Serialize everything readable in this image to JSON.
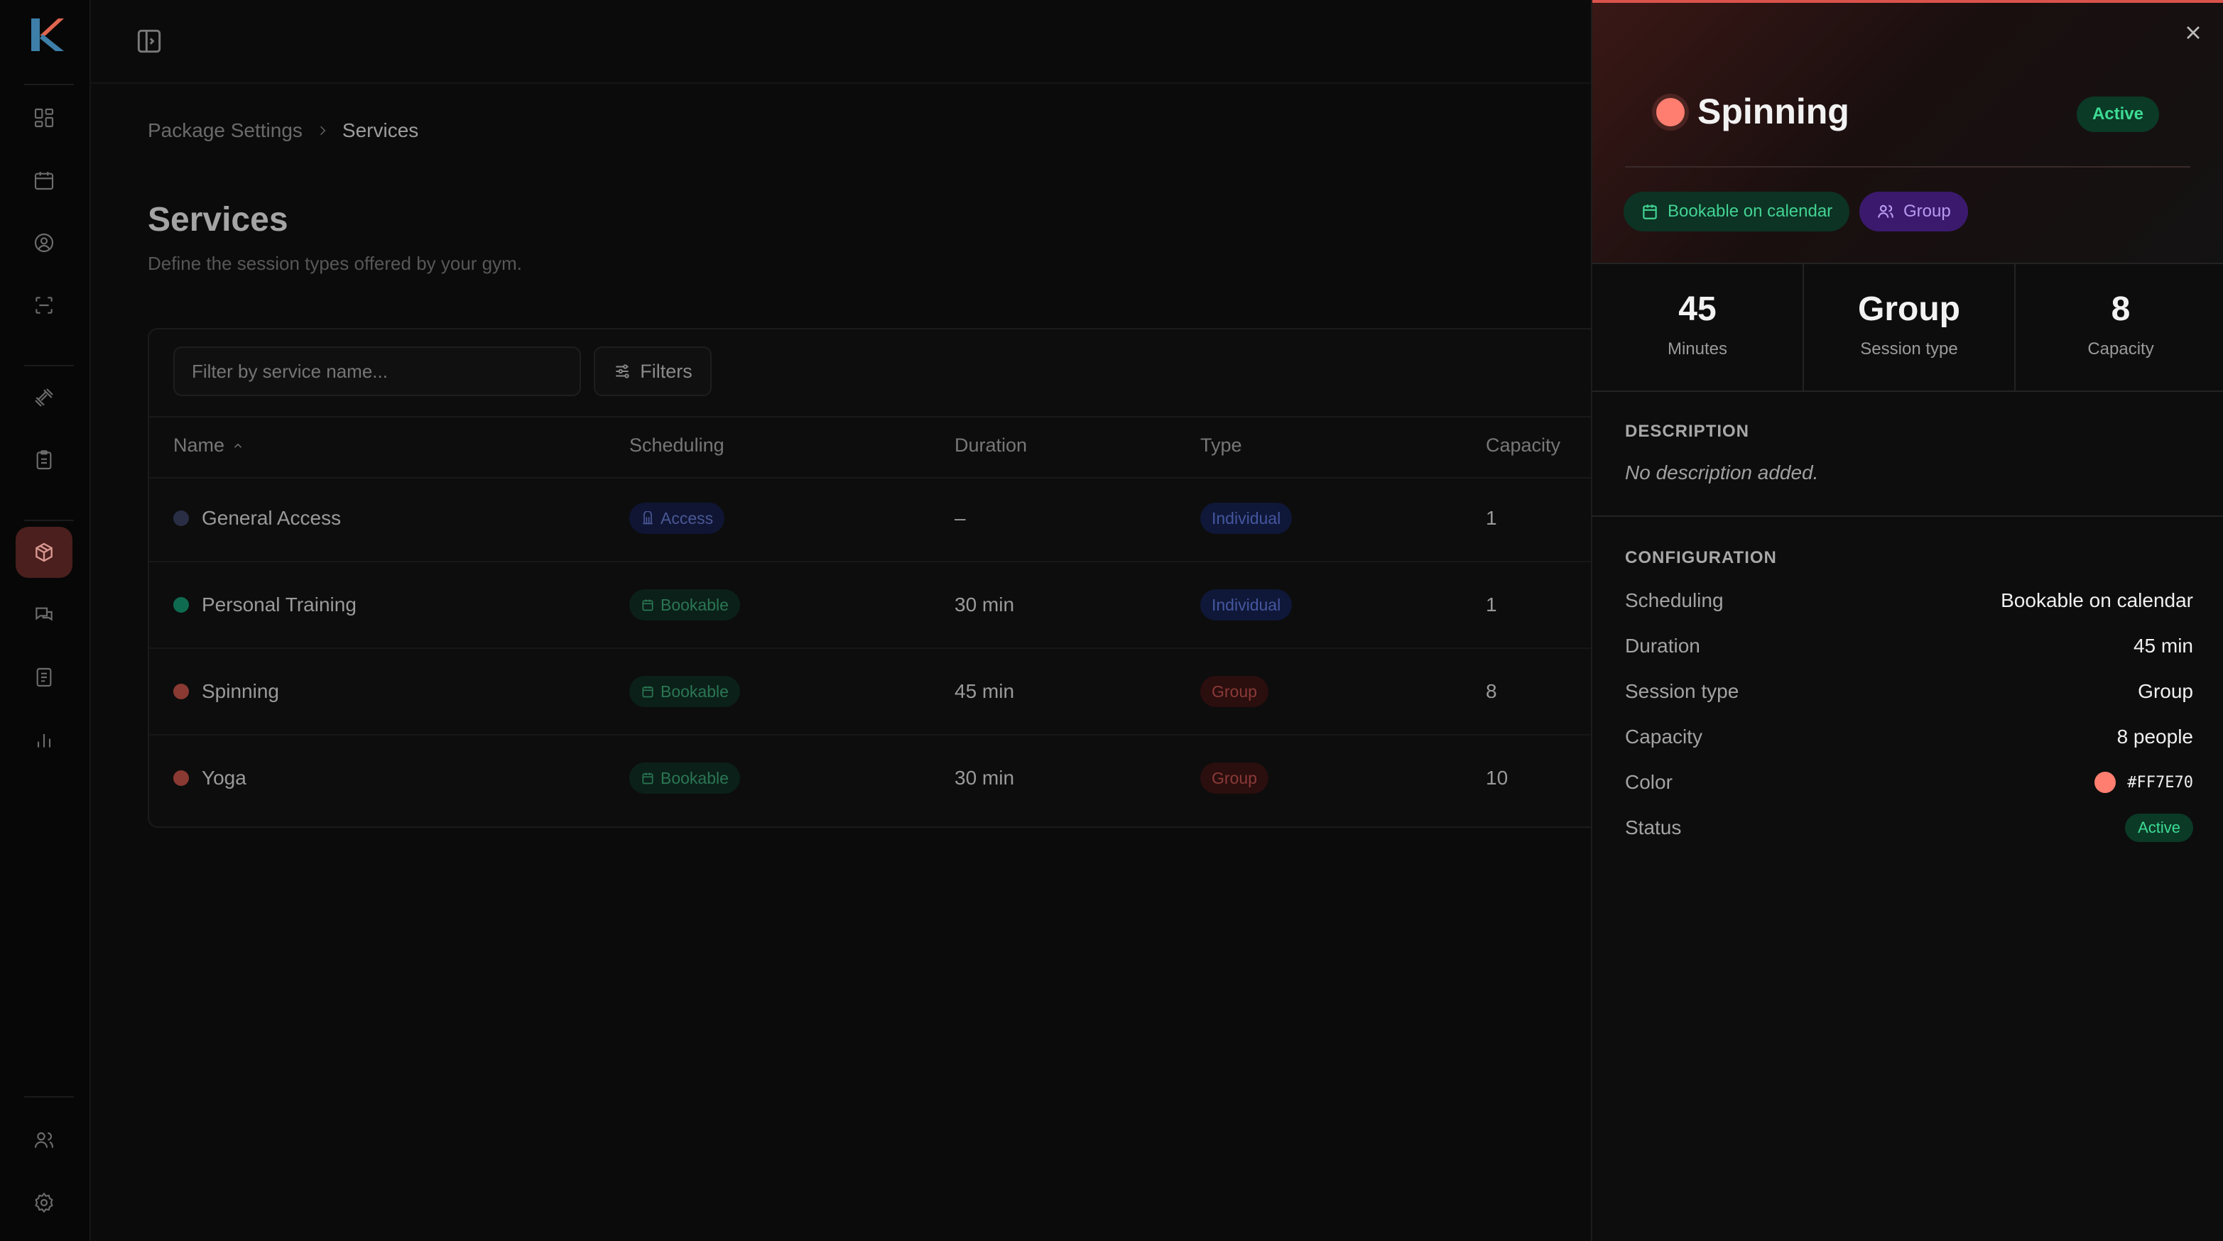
{
  "colors": {
    "accent": "#d9534c",
    "service_color": "#FF7E70",
    "active_green": "#3ddc94",
    "group_purple": "#b79af0"
  },
  "rail": {
    "logo": "K",
    "icons": [
      "dashboard-icon",
      "calendar-icon",
      "user-circle-icon",
      "scan-icon",
      "dumbbell-icon",
      "clipboard-icon",
      "package-icon",
      "chat-icon",
      "document-icon",
      "bar-chart-icon",
      "users-icon",
      "gear-icon"
    ]
  },
  "breadcrumb": {
    "parent": "Package Settings",
    "current": "Services"
  },
  "page": {
    "title": "Services",
    "subtitle": "Define the session types offered by your gym."
  },
  "toolbar": {
    "search_placeholder": "Filter by service name...",
    "filters_label": "Filters"
  },
  "table": {
    "columns": [
      "Name",
      "Scheduling",
      "Duration",
      "Type",
      "Capacity"
    ],
    "rows": [
      {
        "name": "General Access",
        "dot": "#2a2e45",
        "scheduling": "Access",
        "duration": "–",
        "type": "Individual",
        "capacity": "1"
      },
      {
        "name": "Personal Training",
        "dot": "#0f6b4f",
        "scheduling": "Bookable",
        "duration": "30 min",
        "type": "Individual",
        "capacity": "1"
      },
      {
        "name": "Spinning",
        "dot": "#8a3a33",
        "scheduling": "Bookable",
        "duration": "45 min",
        "type": "Group",
        "capacity": "8"
      },
      {
        "name": "Yoga",
        "dot": "#8a3a33",
        "scheduling": "Bookable",
        "duration": "30 min",
        "type": "Group",
        "capacity": "10"
      }
    ]
  },
  "panel": {
    "title": "Spinning",
    "status": "Active",
    "tags": {
      "scheduling": "Bookable on calendar",
      "type": "Group"
    },
    "stats": [
      {
        "value": "45",
        "label": "Minutes"
      },
      {
        "value": "Group",
        "label": "Session type"
      },
      {
        "value": "8",
        "label": "Capacity"
      }
    ],
    "description_heading": "DESCRIPTION",
    "description": "No description added.",
    "configuration_heading": "CONFIGURATION",
    "config": {
      "scheduling_key": "Scheduling",
      "scheduling_val": "Bookable on calendar",
      "duration_key": "Duration",
      "duration_val": "45 min",
      "type_key": "Session type",
      "type_val": "Group",
      "capacity_key": "Capacity",
      "capacity_val": "8 people",
      "color_key": "Color",
      "color_val": "#FF7E70",
      "status_key": "Status",
      "status_val": "Active"
    }
  }
}
